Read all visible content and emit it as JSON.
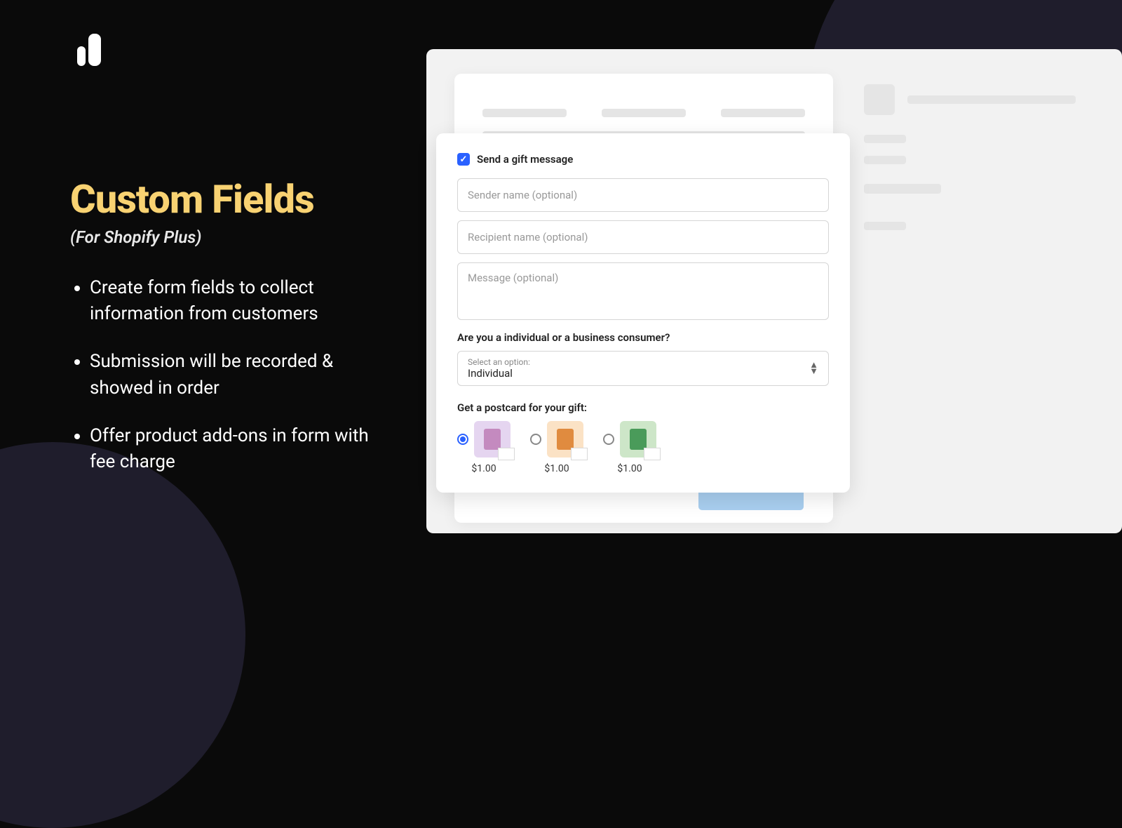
{
  "left": {
    "headline": "Custom Fields",
    "subhead": "(For Shopify Plus)",
    "bullets": [
      "Create form fields to collect information from customers",
      "Submission will be recorded & showed in order",
      "Offer product add-ons in form with fee charge"
    ]
  },
  "form": {
    "checkbox_label": "Send a gift message",
    "sender_placeholder": "Sender name (optional)",
    "recipient_placeholder": "Recipient name (optional)",
    "message_placeholder": "Message (optional)",
    "consumer_question": "Are you a individual or a business consumer?",
    "select_hint": "Select an option:",
    "select_value": "Individual",
    "postcard_label": "Get a postcard for your gift:",
    "postcards": [
      {
        "price": "$1.00",
        "selected": true
      },
      {
        "price": "$1.00",
        "selected": false
      },
      {
        "price": "$1.00",
        "selected": false
      }
    ]
  }
}
